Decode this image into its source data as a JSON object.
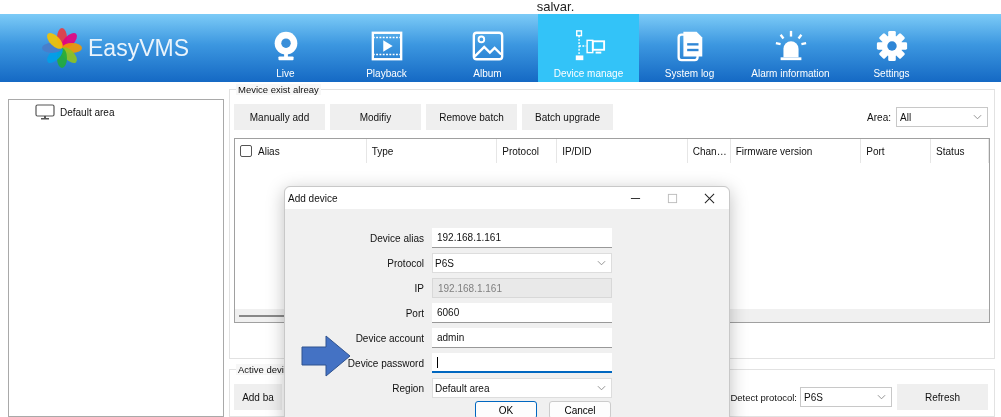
{
  "caption": "salvar.",
  "app": {
    "name": "EasyVMS"
  },
  "nav": [
    {
      "label": "Live",
      "kind": "webcam",
      "selected": false
    },
    {
      "label": "Playback",
      "kind": "film",
      "selected": false
    },
    {
      "label": "Album",
      "kind": "image",
      "selected": false
    },
    {
      "label": "Device manage",
      "kind": "devices",
      "selected": true
    },
    {
      "label": "System log",
      "kind": "document",
      "selected": false
    },
    {
      "label": "Alarm information",
      "kind": "alarm",
      "selected": false
    },
    {
      "label": "Settings",
      "kind": "gear",
      "selected": false
    }
  ],
  "tree": {
    "items": [
      {
        "label": "Default area"
      }
    ]
  },
  "device_group": {
    "title": "Mevice exist alreay",
    "buttons": [
      "Manually add",
      "Modifiy",
      "Remove batch",
      "Batch upgrade"
    ],
    "area": {
      "label": "Area:",
      "value": "All"
    },
    "table": {
      "select_all_checked": false,
      "columns": [
        "Alias",
        "Type",
        "Protocol",
        "IP/DID",
        "Chan…",
        "Firmware version",
        "Port",
        "Status"
      ]
    }
  },
  "active_group": {
    "title": "Active devi",
    "buttons": [
      "Add ba"
    ],
    "detect": {
      "label": "Detect protocol:",
      "value": "P6S"
    },
    "refresh": "Refresh"
  },
  "dialog": {
    "title": "Add device",
    "fields": [
      {
        "label": "Device alias",
        "kind": "text",
        "value": "192.168.1.161",
        "disabled": false,
        "focused": false
      },
      {
        "label": "Protocol",
        "kind": "select",
        "value": "P6S",
        "disabled": false,
        "focused": false
      },
      {
        "label": "IP",
        "kind": "text",
        "value": "192.168.1.161",
        "disabled": true,
        "focused": false
      },
      {
        "label": "Port",
        "kind": "text",
        "value": "6060",
        "disabled": false,
        "focused": false
      },
      {
        "label": "Device account",
        "kind": "text",
        "value": "admin",
        "disabled": false,
        "focused": false
      },
      {
        "label": "Device password",
        "kind": "text",
        "disabled": false,
        "focused": true
      },
      {
        "label": "Region",
        "kind": "select",
        "value": "Default area",
        "disabled": false,
        "focused": false
      }
    ],
    "buttons": [
      {
        "label": "OK",
        "default": true
      },
      {
        "label": "Cancel",
        "default": false
      }
    ]
  }
}
